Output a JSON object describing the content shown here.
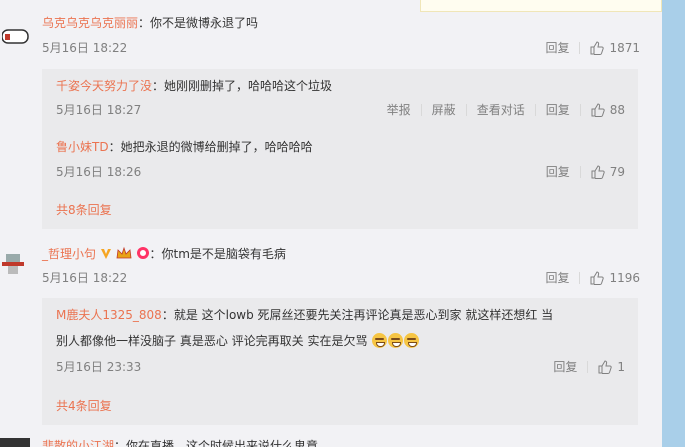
{
  "comments": [
    {
      "user": "乌克乌克乌克丽丽",
      "text": "：你不是微博永退了吗",
      "time": "5月16日 18:22",
      "reply_label": "回复",
      "likes": "1871",
      "replies": [
        {
          "user": "千姿今天努力了没",
          "text": "：她刚刚删掉了，哈哈哈这个垃圾",
          "time": "5月16日 18:27",
          "report_label": "举报",
          "block_label": "屏蔽",
          "view_conv_label": "查看对话",
          "reply_label": "回复",
          "likes": "88"
        },
        {
          "user": "鲁小妹TD",
          "text": "：她把永退的微博给删掉了，哈哈哈哈",
          "time": "5月16日 18:26",
          "reply_label": "回复",
          "likes": "79"
        }
      ],
      "more_label": "共8条回复"
    },
    {
      "user": "_哲理小句",
      "text": "：你tm是不是脑袋有毛病",
      "time": "5月16日 18:22",
      "reply_label": "回复",
      "likes": "1196",
      "replies": [
        {
          "user": "M鹿夫人1325_808",
          "text_line1": "：就是 这个lowb 死屌丝还要先关注再评论真是恶心到家 就这样还想红 当",
          "text_line2": "别人都像他一样没脑子 真是恶心 评论完再取关 实在是欠骂",
          "time": "5月16日 23:33",
          "reply_label": "回复",
          "likes": "1"
        }
      ],
      "more_label": "共4条回复"
    },
    {
      "user": "悲散的小江湖",
      "text": "：你在直播，这个时候出来说什么鬼意"
    }
  ],
  "colors": {
    "accent": "#eb7350",
    "meta": "#808080",
    "reply_bg": "#eaeaec",
    "page_bg": "#f2f2f5",
    "scroll_bar": "#a9cfe9"
  }
}
